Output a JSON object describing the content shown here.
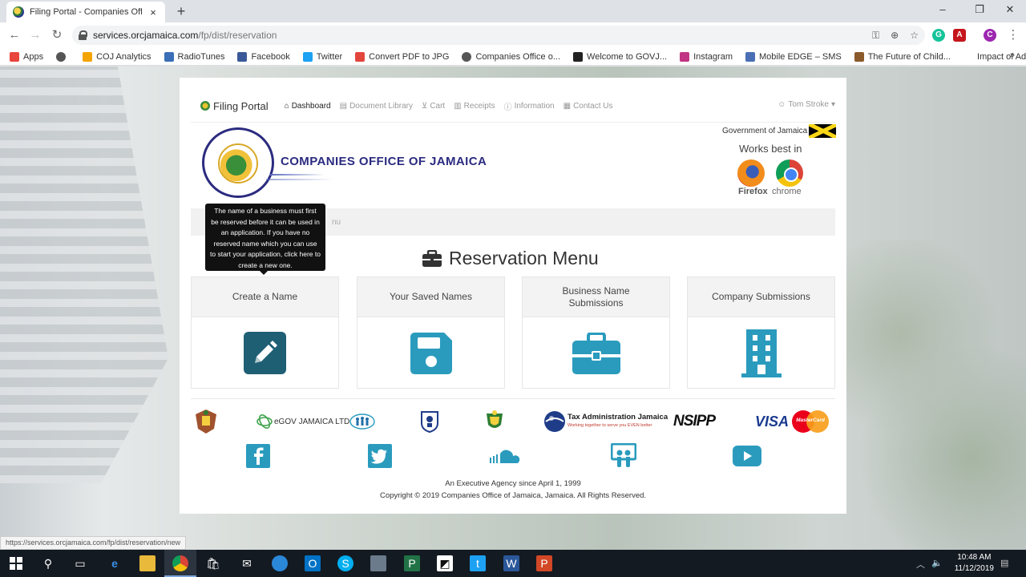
{
  "browser": {
    "tab_title": "Filing Portal - Companies Office",
    "tab_close": "×",
    "new_tab": "+",
    "win_min": "–",
    "win_max": "❐",
    "win_close": "✕",
    "url_host": "services.orcjamaica.com",
    "url_path": "/fp/dist/reservation",
    "status_url": "https://services.orcjamaica.com/fp/dist/reservation/new",
    "profile_initial": "C"
  },
  "bookmarks": [
    {
      "label": "Apps",
      "color": "#e8453c"
    },
    {
      "label": "",
      "color": "#555555"
    },
    {
      "label": "COJ Analytics",
      "color": "#f4a400"
    },
    {
      "label": "RadioTunes",
      "color": "#3a6fb7"
    },
    {
      "label": "Facebook",
      "color": "#3b5998"
    },
    {
      "label": "Twitter",
      "color": "#1da1f2"
    },
    {
      "label": "Convert PDF to JPG",
      "color": "#e2453c"
    },
    {
      "label": "Companies Office o...",
      "color": "#555555"
    },
    {
      "label": "Welcome to GOVJ...",
      "color": "#222222"
    },
    {
      "label": "Instagram",
      "color": "#c13584"
    },
    {
      "label": "Mobile EDGE – SMS",
      "color": "#4a6fb5"
    },
    {
      "label": "The Future of Child...",
      "color": "#8a5a2b"
    },
    {
      "label": "Impact of Adoption...",
      "color": "#ffffff"
    }
  ],
  "bookmarks_more": "»",
  "portal_nav": {
    "brand": "Filing Portal",
    "items": [
      "Dashboard",
      "Document Library",
      "Cart",
      "Receipts",
      "Information",
      "Contact Us"
    ],
    "user": "Tom Stroke"
  },
  "header": {
    "org_name": "COMPANIES OFFICE OF JAMAICA",
    "gov_label": "Government of Jamaica",
    "works_best": "Works best in",
    "firefox": "Firefox",
    "chrome": "chrome"
  },
  "breadcrumb_text": "nu",
  "tooltip": "The name of a business must first be reserved before it can be used in an application. If you have no reserved name which you can use to start your application, click here to create a new one.",
  "menu_title": "Reservation Menu",
  "tiles": [
    {
      "label": "Create a Name",
      "icon": "pencil-square-icon"
    },
    {
      "label": "Your Saved Names",
      "icon": "floppy-disk-icon"
    },
    {
      "label": "Business Name Submissions",
      "icon": "briefcase-icon"
    },
    {
      "label": "Company Submissions",
      "icon": "building-icon"
    }
  ],
  "partners": {
    "egov": "eGOV JAMAICA LTD.",
    "tax": "Tax Administration Jamaica",
    "tax_sub": "Working together to serve you EVEN better",
    "nsipp": "NSIPP",
    "visa": "VISA",
    "mastercard": "MasterCard"
  },
  "footer": {
    "agency": "An Executive Agency since April 1, 1999",
    "copyright": "Copyright © 2019 Companies Office of Jamaica, Jamaica. All Rights Reserved."
  },
  "taskbar": {
    "time": "10:48 AM",
    "date": "11/12/2019"
  },
  "colors": {
    "icon_dark_teal": "#1e5f74",
    "icon_teal": "#2a9bbd",
    "brand_navy": "#2b2b80"
  }
}
